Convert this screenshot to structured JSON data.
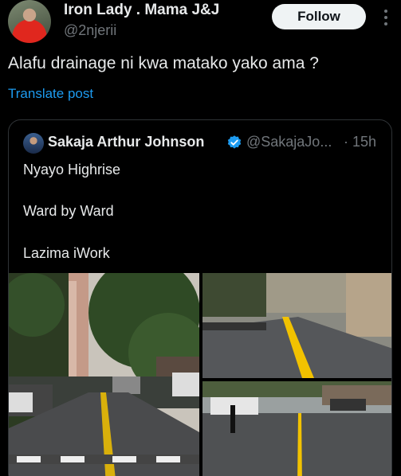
{
  "author": {
    "display_name": "Iron Lady . Mama J&J",
    "handle": "@2njerii",
    "follow_label": "Follow",
    "more_icon": "more-vertical-icon"
  },
  "post": {
    "text": "Alafu drainage ni kwa matako yako ama ?",
    "translate_label": "Translate post"
  },
  "quoted": {
    "display_name": "Sakaja Arthur Johnson",
    "handle": "@SakajaJo...",
    "time": "· 15h",
    "verified_icon": "verified-badge-icon",
    "lines": [
      "Nyayo Highrise",
      "Ward by Ward",
      "Lazima iWork"
    ]
  },
  "colors": {
    "background": "#000000",
    "text": "#e7e9ea",
    "secondary": "#71767b",
    "link": "#1d9bf0",
    "road_marking": "#f2c200"
  }
}
